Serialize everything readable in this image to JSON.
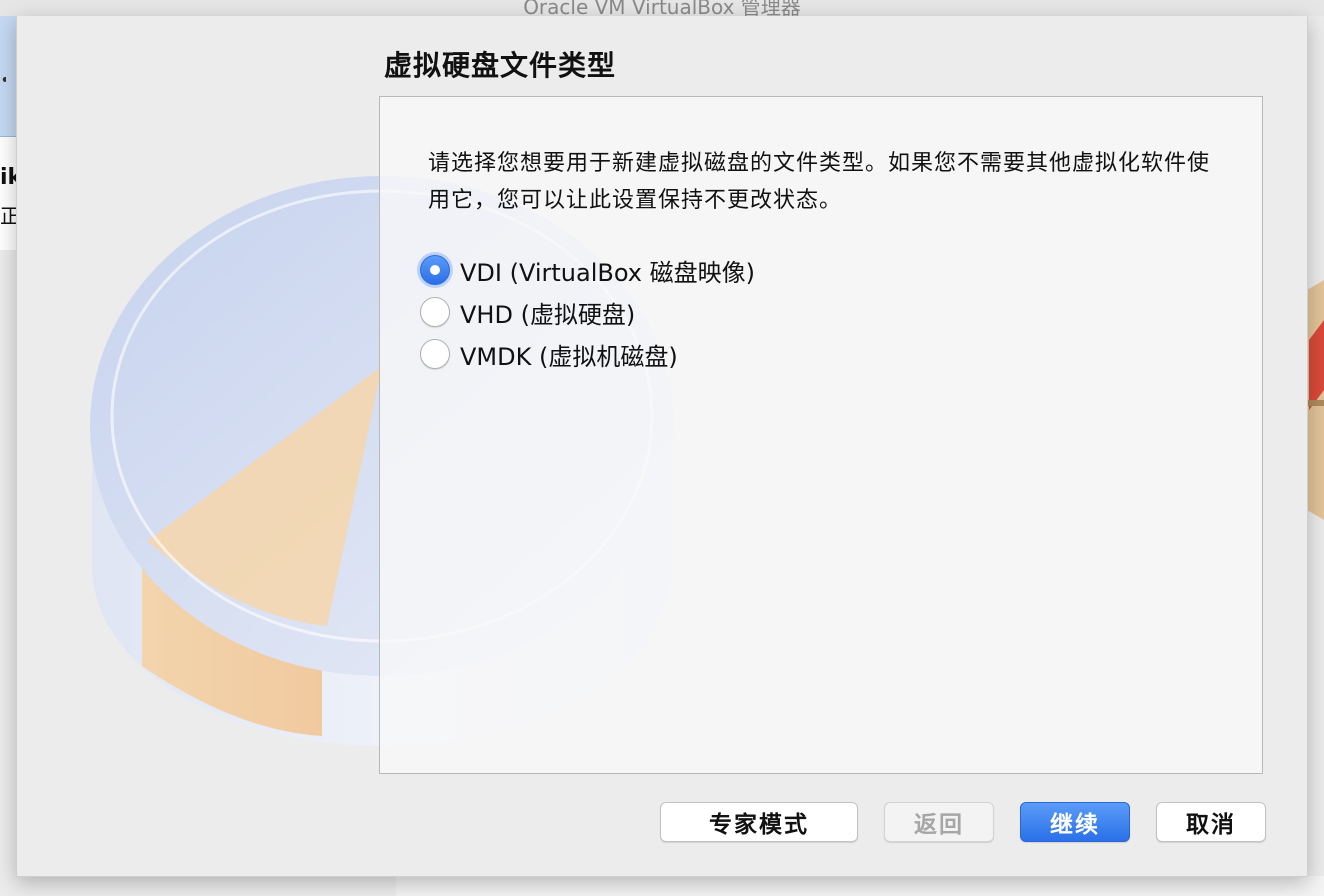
{
  "parent_window": {
    "title": "Oracle VM VirtualBox 管理器",
    "sidebar_name_fragment": "ik",
    "sidebar_status_fragment": "正",
    "sidebar_icon_fragment": "•"
  },
  "dialog": {
    "title": "虚拟硬盘文件类型",
    "description": "请选择您想要用于新建虚拟磁盘的文件类型。如果您不需要其他虚拟化软件使用它，您可以让此设置保持不更改状态。",
    "options": [
      {
        "label": "VDI (VirtualBox 磁盘映像)",
        "checked": true
      },
      {
        "label": "VHD (虚拟硬盘)",
        "checked": false
      },
      {
        "label": "VMDK (虚拟机磁盘)",
        "checked": false
      }
    ],
    "buttons": {
      "expert": "专家模式",
      "back": "返回",
      "continue": "继续",
      "cancel": "取消"
    }
  },
  "colors": {
    "accent": "#2b6fe6",
    "disk_blue": "#c9d6ef",
    "disk_orange": "#f6d3a6"
  },
  "icons": {
    "disk": "hard-disk-pie-icon"
  }
}
